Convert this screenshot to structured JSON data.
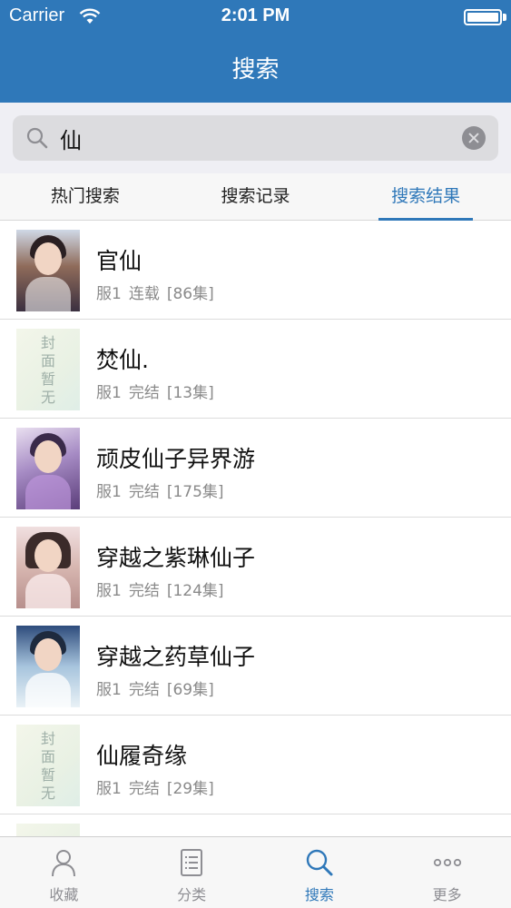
{
  "status_bar": {
    "carrier": "Carrier",
    "time": "2:01 PM"
  },
  "nav": {
    "title": "搜索"
  },
  "search": {
    "value": "仙"
  },
  "tabs": [
    {
      "label": "热门搜索",
      "active": false
    },
    {
      "label": "搜索记录",
      "active": false
    },
    {
      "label": "搜索结果",
      "active": true
    }
  ],
  "results": [
    {
      "title": "官仙",
      "source": "服1",
      "status": "连载",
      "episodes": "[86集]",
      "cover": "illustrated-male-portrait"
    },
    {
      "title": "焚仙.",
      "source": "服1",
      "status": "完结",
      "episodes": "[13集]",
      "cover": "placeholder",
      "cover_text": "封面暂无"
    },
    {
      "title": "顽皮仙子异界游",
      "source": "服1",
      "status": "完结",
      "episodes": "[175集]",
      "cover": "illustrated-purple"
    },
    {
      "title": "穿越之紫琳仙子",
      "source": "服1",
      "status": "完结",
      "episodes": "[124集]",
      "cover": "illustrated-female-portrait"
    },
    {
      "title": "穿越之药草仙子",
      "source": "服1",
      "status": "完结",
      "episodes": "[69集]",
      "cover": "illustrated-blue"
    },
    {
      "title": "仙履奇缘",
      "source": "服1",
      "status": "完结",
      "episodes": "[29集]",
      "cover": "placeholder",
      "cover_text": "封面暂无"
    }
  ],
  "tabbar": [
    {
      "label": "收藏",
      "icon": "person-icon",
      "active": false
    },
    {
      "label": "分类",
      "icon": "list-icon",
      "active": false
    },
    {
      "label": "搜索",
      "icon": "search-icon",
      "active": true
    },
    {
      "label": "更多",
      "icon": "more-icon",
      "active": false
    }
  ],
  "colors": {
    "brand": "#2f78b9",
    "meta_text": "#8a8a8a",
    "tab_inactive": "#8e8e93"
  }
}
